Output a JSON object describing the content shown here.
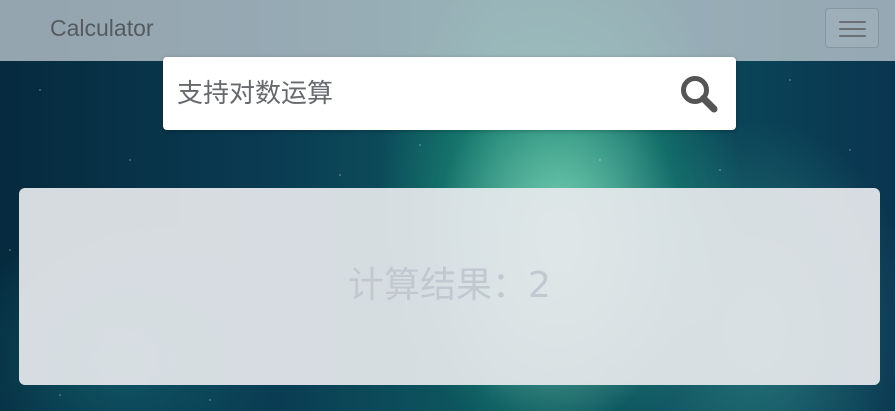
{
  "navbar": {
    "brand": "Calculator",
    "menu_toggle_icon": "hamburger-menu-icon"
  },
  "search": {
    "placeholder": "支持对数运算",
    "value": "",
    "button_icon": "search-icon"
  },
  "result": {
    "text": "计算结果：2"
  },
  "colors": {
    "navbar_bg": "#cdd4da",
    "result_text": "#c2c8d0",
    "search_icon": "#555555"
  }
}
